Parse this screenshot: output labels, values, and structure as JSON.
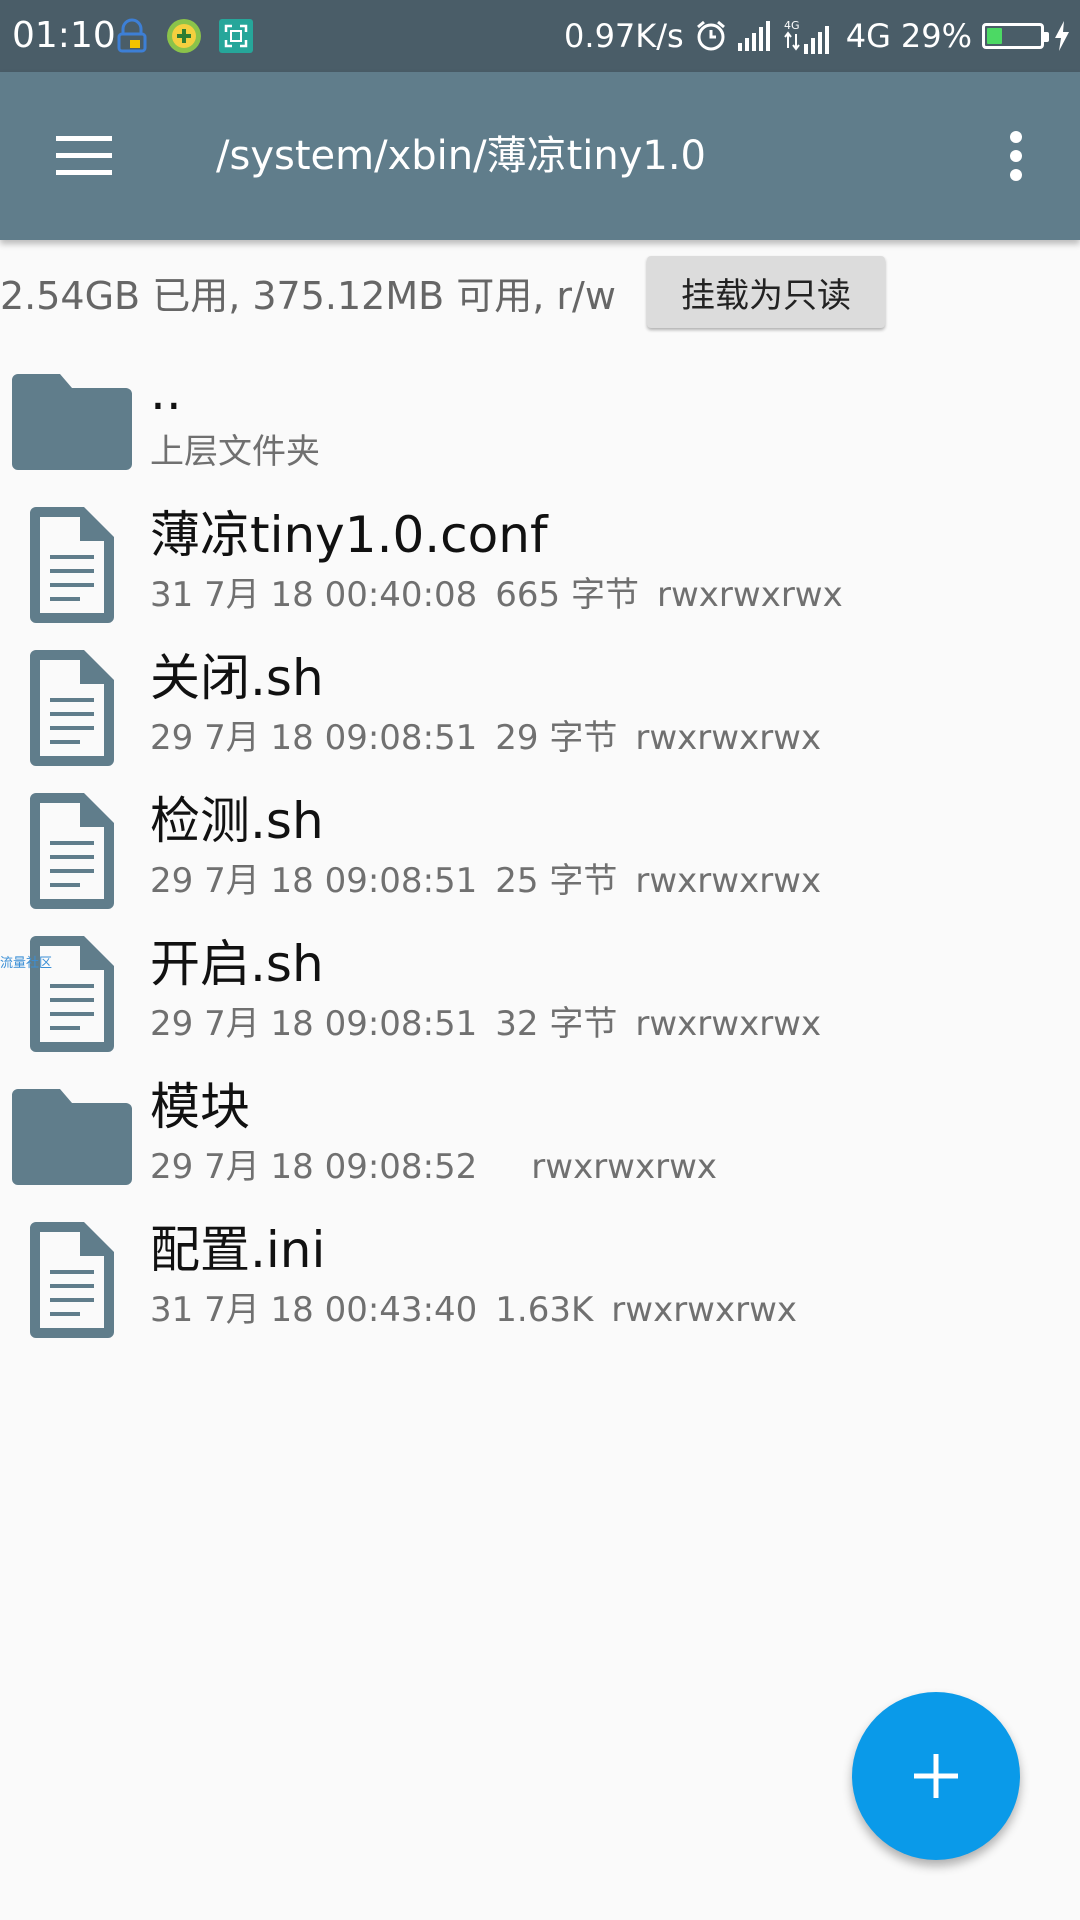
{
  "status_bar": {
    "time": "01:10",
    "net_speed": "0.97K/s",
    "network_type": "4G",
    "battery_percent": "29%",
    "battery_level": 0.29,
    "app_icons": [
      "vpn-lock-icon",
      "add-coin-icon",
      "screenshot-scan-icon"
    ],
    "indicator_icons": [
      "alarm-icon",
      "signal-icon",
      "signal-4g-icon",
      "battery-icon",
      "charging-icon"
    ]
  },
  "app_bar": {
    "title": "/system/xbin/薄凉tiny1.0",
    "menu_icon": "hamburger-menu-icon",
    "overflow_icon": "more-vert-icon"
  },
  "storage": {
    "info": "2.54GB 已用, 375.12MB 可用, r/w",
    "mount_button": "挂载为只读"
  },
  "files": [
    {
      "type": "folder",
      "name": "..",
      "date": "上层文件夹",
      "size": "",
      "perms": ""
    },
    {
      "type": "file",
      "name": "薄凉tiny1.0.conf",
      "date": "31 7月 18 00:40:08",
      "size": "665 字节",
      "perms": "rwxrwxrwx"
    },
    {
      "type": "file",
      "name": "关闭.sh",
      "date": "29 7月 18 09:08:51",
      "size": "29 字节",
      "perms": "rwxrwxrwx"
    },
    {
      "type": "file",
      "name": "检测.sh",
      "date": "29 7月 18 09:08:51",
      "size": "25 字节",
      "perms": "rwxrwxrwx"
    },
    {
      "type": "file",
      "name": "开启.sh",
      "date": "29 7月 18 09:08:51",
      "size": "32 字节",
      "perms": "rwxrwxrwx"
    },
    {
      "type": "folder",
      "name": "模块",
      "date": "29 7月 18 09:08:52",
      "size": "",
      "perms": "rwxrwxrwx"
    },
    {
      "type": "file",
      "name": "配置.ini",
      "date": "31 7月 18 00:43:40",
      "size": "1.63K",
      "perms": "rwxrwxrwx"
    }
  ],
  "watermark": "流量社区",
  "fab": {
    "icon": "add-icon"
  },
  "colors": {
    "status_bar": "#4a5d68",
    "app_bar": "#607d8b",
    "icon": "#607d8b",
    "fab": "#0a9ae9",
    "background": "#fafafa"
  }
}
